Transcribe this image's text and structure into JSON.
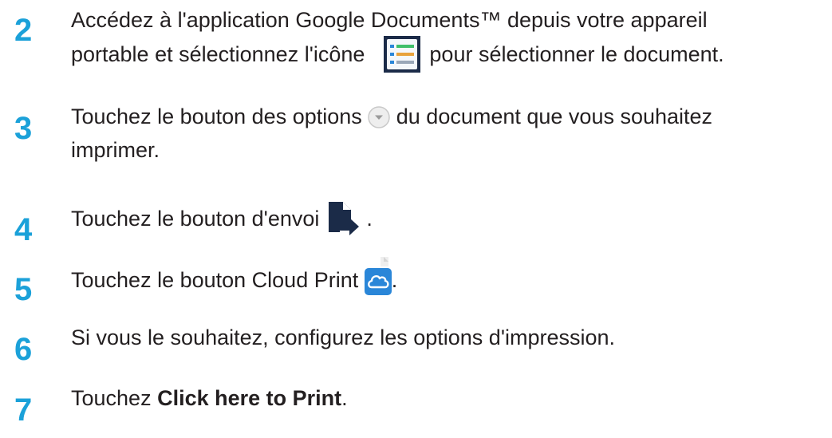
{
  "steps": [
    {
      "number": "2",
      "line1": "Accédez à l'application Google Documents™ depuis votre appareil",
      "line2_before": "portable et sélectionnez l'icône",
      "line2_after": " pour sélectionner le document.",
      "icon": "google-docs-list-icon"
    },
    {
      "number": "3",
      "line1_before": "Touchez le bouton des options ",
      "line1_after": " du document que vous souhaitez",
      "line2": "imprimer.",
      "icon": "options-dropdown-icon"
    },
    {
      "number": "4",
      "before": "Touchez le bouton d'envoi ",
      "after": " .",
      "icon": "send-document-icon"
    },
    {
      "number": "5",
      "before": "Touchez le bouton Cloud Print ",
      "after": ".",
      "icon": "cloud-print-icon"
    },
    {
      "number": "6",
      "text": "Si vous le souhaitez, configurez les options d'impression."
    },
    {
      "number": "7",
      "before": "Touchez ",
      "bold": "Click here to Print",
      "after": "."
    }
  ],
  "colors": {
    "step_number": "#1ba1d9",
    "text": "#231f20",
    "icon_navy": "#1b2b48",
    "cloud_blue": "#2a86d8"
  }
}
